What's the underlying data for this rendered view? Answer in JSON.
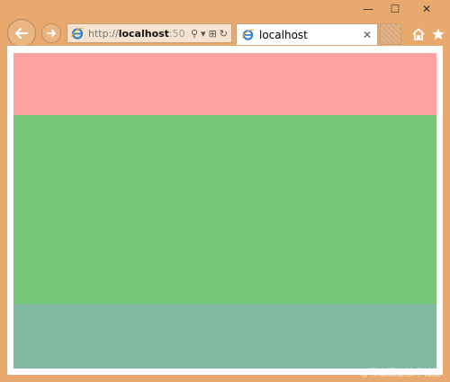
{
  "window": {
    "controls": {
      "minimize": "—",
      "maximize": "☐",
      "close": "✕"
    }
  },
  "address_bar": {
    "url_prefix": "http://",
    "url_host": "localhost",
    "url_port": ":50",
    "search_glyph": "⚲",
    "dropdown_glyph": "▾",
    "compat_glyph": "⊞",
    "refresh_glyph": "↻"
  },
  "tab": {
    "title": "localhost",
    "close_glyph": "✕"
  },
  "page": {
    "colors": {
      "top": "#fea2a2",
      "middle": "#75c777",
      "bottom": "#80b99f"
    }
  },
  "watermark": "@稀土掘金技术社区"
}
